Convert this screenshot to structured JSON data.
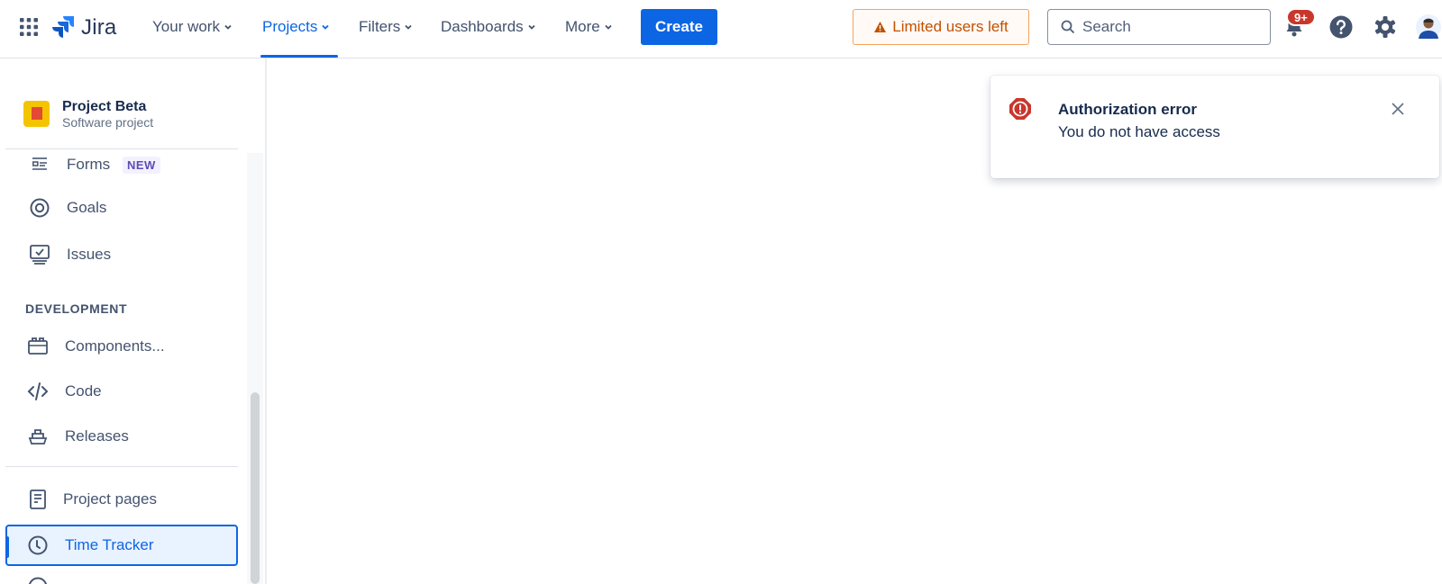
{
  "topnav": {
    "logo_text": "Jira",
    "items": [
      {
        "label": "Your work"
      },
      {
        "label": "Projects"
      },
      {
        "label": "Filters"
      },
      {
        "label": "Dashboards"
      },
      {
        "label": "More"
      }
    ],
    "active_item": "Projects",
    "create_label": "Create",
    "limited_label": "Limited users left",
    "search_placeholder": "Search",
    "notification_badge": "9+",
    "icons": [
      "app-switcher-icon",
      "jira-logo-icon",
      "notifications-icon",
      "help-icon",
      "settings-icon",
      "profile-avatar"
    ]
  },
  "sidebar": {
    "project_name": "Project Beta",
    "project_type": "Software project",
    "items_top": [
      {
        "label": "Forms",
        "icon": "forms-icon",
        "lozenge": "NEW"
      },
      {
        "label": "Goals",
        "icon": "goals-icon"
      },
      {
        "label": "Issues",
        "icon": "issues-icon"
      }
    ],
    "section_development": "DEVELOPMENT",
    "items_dev": [
      {
        "label": "Components...",
        "icon": "components-icon"
      },
      {
        "label": "Code",
        "icon": "code-icon"
      },
      {
        "label": "Releases",
        "icon": "releases-icon"
      }
    ],
    "items_bottom": [
      {
        "label": "Project pages",
        "icon": "page-icon"
      },
      {
        "label": "Time Tracker",
        "icon": "clock-icon",
        "selected": true
      }
    ]
  },
  "flag": {
    "title": "Authorization error",
    "description": "You do not have access",
    "icon": "error-icon"
  },
  "colors": {
    "brand_blue": "#0c66e4",
    "warning_orange": "#c25100",
    "error_red": "#c9372c"
  }
}
